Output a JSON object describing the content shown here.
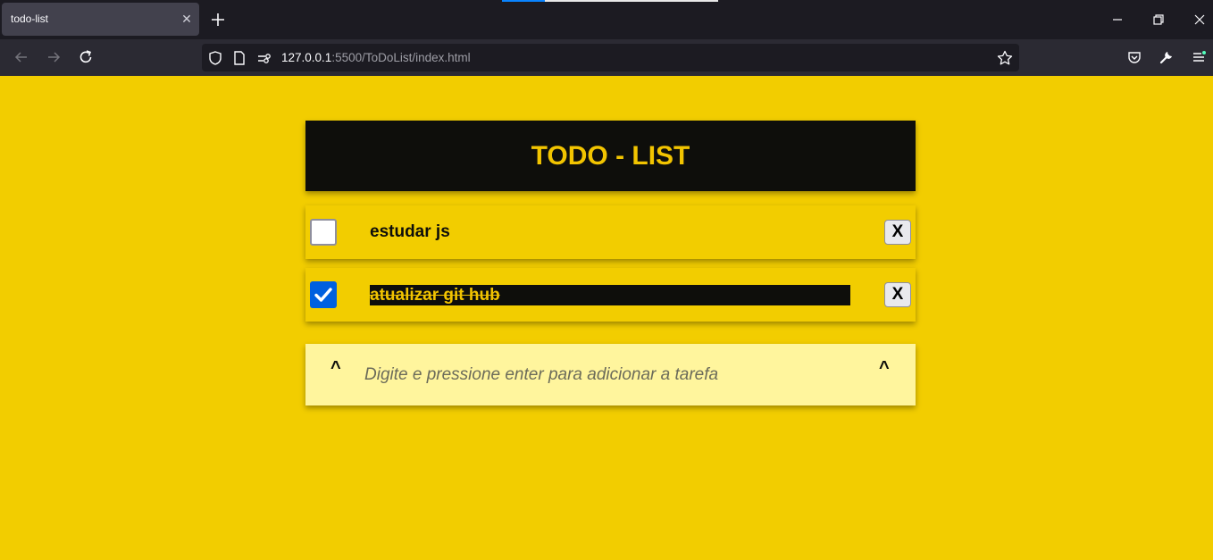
{
  "browser": {
    "tab_title": "todo-list",
    "tab_close_glyph": "✕",
    "url_host": "127.0.0.1",
    "url_rest": ":5500/ToDoList/index.html",
    "icons": [
      "back-icon",
      "forward-icon",
      "reload-icon",
      "shield-icon",
      "page-icon",
      "permissions-icon",
      "star-icon",
      "pocket-icon",
      "wrench-icon",
      "menu-icon",
      "minimize-icon",
      "restore-icon",
      "close-icon",
      "new-tab-icon"
    ]
  },
  "app": {
    "title": "TODO - LIST",
    "tasks": [
      {
        "text": "estudar js",
        "done": false,
        "delete_label": "X"
      },
      {
        "text": "atualizar git hub",
        "done": true,
        "delete_label": "X"
      }
    ],
    "add": {
      "caret_left": "^",
      "caret_right": "^",
      "placeholder": "Digite e pressione enter para adicionar a tarefa"
    },
    "colors": {
      "background": "#f2cd00",
      "header_bg": "#0e0e0b",
      "title": "#f2c400",
      "input_bg": "#fff59d",
      "checkbox_checked": "#0060df"
    }
  }
}
